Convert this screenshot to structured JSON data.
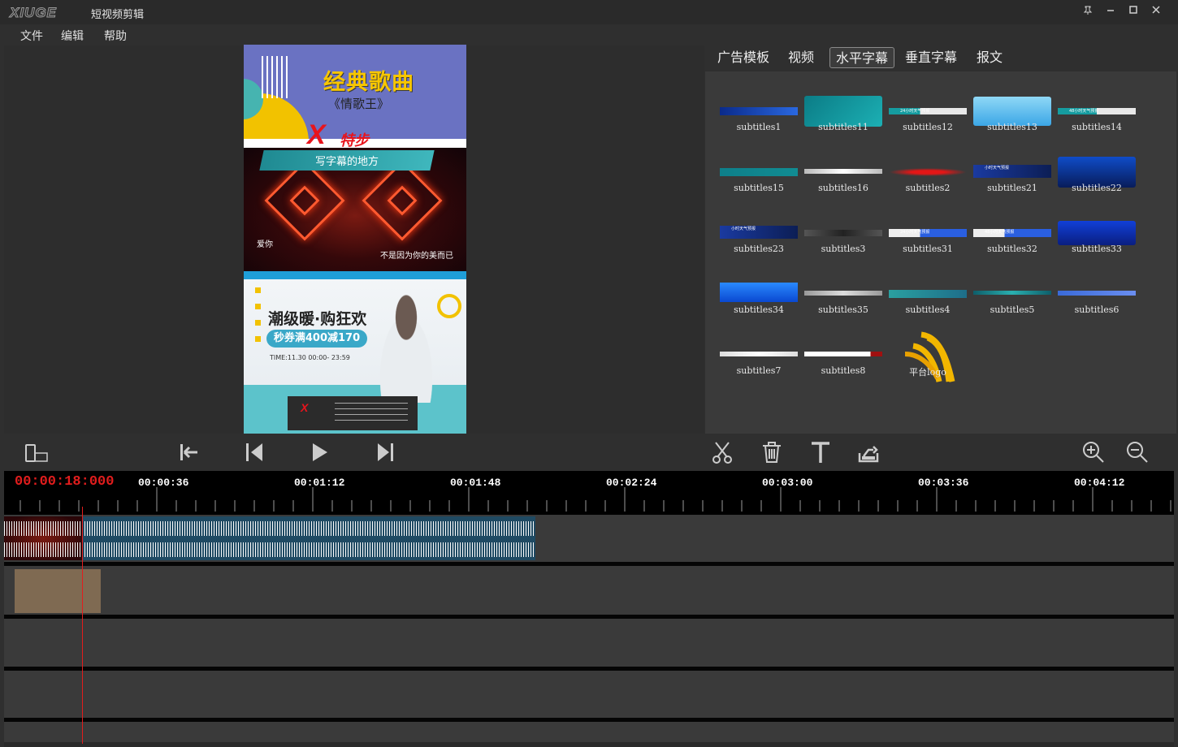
{
  "window": {
    "logo": "XIUGE",
    "title": "短视频剪辑",
    "controls": [
      "pin-icon",
      "minimize-icon",
      "maximize-icon",
      "close-icon"
    ]
  },
  "menu": [
    "文件",
    "编辑",
    "帮助"
  ],
  "preview": {
    "top_title": "经典歌曲",
    "top_subtitle": "《情歌王》",
    "brand_x": "X",
    "brand_text": "特步",
    "subtitle_bar_text": "写字幕的地方",
    "caption_left": "爱你",
    "caption_right": "不是因为你的美而已",
    "promo_title": "潮级暖·购狂欢",
    "promo_coupon": "秒券满400减170",
    "promo_time": "TIME:11.30 00:00- 23:59"
  },
  "tabs": {
    "items": [
      "广告模板",
      "视频",
      "水平字幕",
      "垂直字幕",
      "报文"
    ],
    "active": "水平字幕"
  },
  "templates": [
    {
      "label": "subtitles1",
      "thumb_text": ""
    },
    {
      "label": "subtitles11",
      "thumb_text": ""
    },
    {
      "label": "subtitles12",
      "thumb_text": "24小时天气预报"
    },
    {
      "label": "subtitles13",
      "thumb_text": ""
    },
    {
      "label": "subtitles14",
      "thumb_text": "48小时天气预报"
    },
    {
      "label": "subtitles15",
      "thumb_text": ""
    },
    {
      "label": "subtitles16",
      "thumb_text": ""
    },
    {
      "label": "subtitles2",
      "thumb_text": ""
    },
    {
      "label": "subtitles21",
      "thumb_text": "小时天气预报"
    },
    {
      "label": "subtitles22",
      "thumb_text": ""
    },
    {
      "label": "subtitles23",
      "thumb_text": "小时天气预报"
    },
    {
      "label": "subtitles3",
      "thumb_text": ""
    },
    {
      "label": "subtitles31",
      "thumb_text": "24小时天气预报"
    },
    {
      "label": "subtitles32",
      "thumb_text": "48小时天气预报"
    },
    {
      "label": "subtitles33",
      "thumb_text": ""
    },
    {
      "label": "subtitles34",
      "thumb_text": ""
    },
    {
      "label": "subtitles35",
      "thumb_text": ""
    },
    {
      "label": "subtitles4",
      "thumb_text": ""
    },
    {
      "label": "subtitles5",
      "thumb_text": ""
    },
    {
      "label": "subtitles6",
      "thumb_text": ""
    },
    {
      "label": "subtitles7",
      "thumb_text": ""
    },
    {
      "label": "subtitles8",
      "thumb_text": ""
    },
    {
      "label": "平台logo",
      "thumb_text": ""
    }
  ],
  "toolbar": {
    "left": [
      "aspect-ratio-icon"
    ],
    "playback": [
      "go-to-start-icon",
      "previous-frame-icon",
      "play-icon",
      "next-frame-icon"
    ],
    "edit": [
      "cut-icon",
      "delete-icon",
      "text-icon",
      "export-icon"
    ],
    "zoom": [
      "zoom-in-icon",
      "zoom-out-icon"
    ]
  },
  "timeline": {
    "current_time": "00:00:18:000",
    "ticks": [
      "00:00:36",
      "00:01:12",
      "00:01:48",
      "00:02:24",
      "00:03:00",
      "00:03:36",
      "00:04:12"
    ]
  },
  "colors": {
    "accent_red": "#e21d1d",
    "audio_clip": "#1f4a63",
    "box_clip": "#7f6a52"
  }
}
